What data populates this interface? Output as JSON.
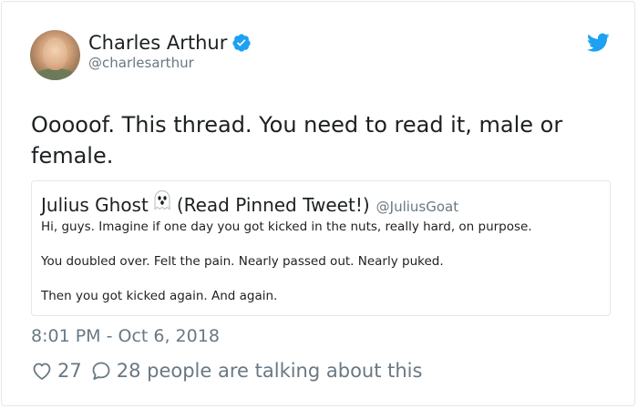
{
  "author": {
    "name": "Charles Arthur",
    "handle": "@charlesarthur",
    "verified": true
  },
  "tweet": {
    "text": "Ooooof. This thread. You need to read it, male or female."
  },
  "quoted_tweet": {
    "name_part1": "Julius Ghost",
    "name_part2": "(Read Pinned Tweet!)",
    "emoji": "ghost-icon",
    "handle": "@JuliusGoat",
    "lines": [
      "Hi, guys. Imagine if one day you got kicked in the nuts, really hard, on purpose.",
      "You doubled over. Felt the pain. Nearly passed out. Nearly puked.",
      "Then you got kicked again. And again."
    ]
  },
  "meta": {
    "timestamp": "8:01 PM - Oct 6, 2018"
  },
  "engagement": {
    "likes": "27",
    "talking": "28 people are talking about this"
  },
  "colors": {
    "twitter_blue": "#1da1f2",
    "text": "#1c2022",
    "muted": "#697882",
    "border": "#e1e8ed"
  }
}
